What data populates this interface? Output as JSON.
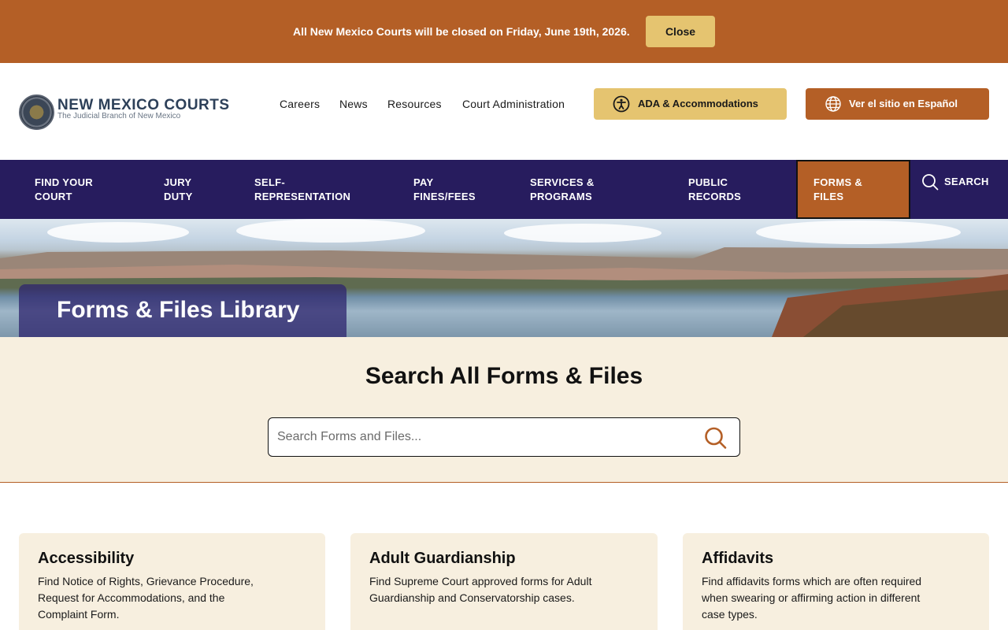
{
  "alert": {
    "message": "All New Mexico Courts will be closed on Friday, June 19th, 2026.",
    "close_label": "Close"
  },
  "header": {
    "logo_title": "NEW MEXICO COURTS",
    "logo_subtitle": "The Judicial Branch of New Mexico",
    "links": [
      "Careers",
      "News",
      "Resources",
      "Court Administration"
    ],
    "ada_label": "ADA & Accommodations",
    "spanish_label": "Ver el sitio en Español"
  },
  "nav": {
    "items": [
      {
        "line1": "FIND YOUR",
        "line2": "COURT"
      },
      {
        "line1": "JURY",
        "line2": "DUTY"
      },
      {
        "line1": "SELF-",
        "line2": "REPRESENTATION"
      },
      {
        "line1": "PAY",
        "line2": "FINES/FEES"
      },
      {
        "line1": "SERVICES &",
        "line2": "PROGRAMS"
      },
      {
        "line1": "PUBLIC",
        "line2": "RECORDS"
      },
      {
        "line1": "FORMS &",
        "line2": "FILES"
      }
    ],
    "search_label": "SEARCH"
  },
  "hero": {
    "title": "Forms & Files Library"
  },
  "search": {
    "heading": "Search All Forms & Files",
    "placeholder": "Search Forms and Files..."
  },
  "cards": [
    {
      "title": "Accessibility",
      "description": "Find Notice of Rights, Grievance Procedure, Request for Accommodations, and the Complaint Form."
    },
    {
      "title": "Adult Guardianship",
      "description": "Find Supreme Court approved forms for Adult Guardianship and Conservatorship cases."
    },
    {
      "title": "Affidavits",
      "description": "Find affidavits forms which are often required when swearing or affirming action in different case types."
    }
  ],
  "colors": {
    "brand_orange": "#b45f26",
    "brand_gold": "#e5c470",
    "nav_purple": "#271c5e",
    "cream": "#f7efdf"
  },
  "icons": {
    "ada": "accessibility-icon",
    "spanish": "globe-icon",
    "nav_search": "search-icon",
    "search_box": "magnifier-icon"
  }
}
